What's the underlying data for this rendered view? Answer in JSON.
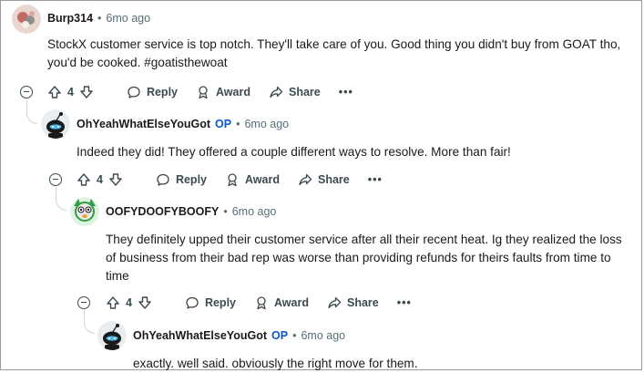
{
  "comments": [
    {
      "author": "Burp314",
      "op_badge": "",
      "time": "6mo ago",
      "lines": [
        "StockX customer service is top notch. They'll take care of you. Good thing you didn't buy from GOAT tho,",
        "you'd be cooked. #goatisthewoat"
      ],
      "votes": "4",
      "avatar": "burp-avatar-icon"
    },
    {
      "author": "OhYeahWhatElseYouGot",
      "op_badge": "OP",
      "time": "6mo ago",
      "lines": [
        "Indeed they did! They offered a couple different ways to resolve. More than fair!"
      ],
      "votes": "4",
      "avatar": "snoo-avatar-icon"
    },
    {
      "author": "OOFYDOOFYBOOFY",
      "op_badge": "",
      "time": "6mo ago",
      "lines": [
        "They definitely upped their customer service after all their recent heat. Ig they realized the loss",
        "of business from their bad rep was worse than providing refunds for theirs faults from time to",
        "time"
      ],
      "votes": "4",
      "avatar": "dog-avatar-icon"
    },
    {
      "author": "OhYeahWhatElseYouGot",
      "op_badge": "OP",
      "time": "6mo ago",
      "lines": [
        "exactly. well said. obviously the right move for them."
      ],
      "avatar": "snoo-avatar-icon"
    }
  ],
  "actions": {
    "reply": "Reply",
    "award": "Award",
    "share": "Share",
    "more": "•••",
    "separator": "•"
  },
  "colors": {
    "op": "#0a57d0",
    "meta": "#576f76",
    "text": "#1a1a1b"
  }
}
